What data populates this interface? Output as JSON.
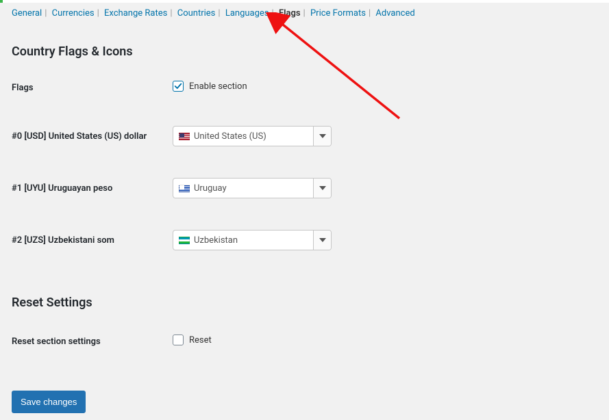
{
  "tabs": [
    {
      "label": "General",
      "active": false
    },
    {
      "label": "Currencies",
      "active": false
    },
    {
      "label": "Exchange Rates",
      "active": false
    },
    {
      "label": "Countries",
      "active": false
    },
    {
      "label": "Languages",
      "active": false
    },
    {
      "label": "Flags",
      "active": true
    },
    {
      "label": "Price Formats",
      "active": false
    },
    {
      "label": "Advanced",
      "active": false
    }
  ],
  "section": {
    "title": "Country Flags & Icons",
    "flags_label": "Flags",
    "enable_label": "Enable section",
    "enable_checked": true
  },
  "currency_rows": [
    {
      "label": "#0 [USD] United States (US) dollar",
      "selected": "United States (US)",
      "flag": "flag-us"
    },
    {
      "label": "#1 [UYU] Uruguayan peso",
      "selected": "Uruguay",
      "flag": "flag-uy"
    },
    {
      "label": "#2 [UZS] Uzbekistani som",
      "selected": "Uzbekistan",
      "flag": "flag-uz"
    }
  ],
  "reset": {
    "title": "Reset Settings",
    "label": "Reset section settings",
    "checkbox_label": "Reset",
    "checked": false
  },
  "buttons": {
    "save": "Save changes"
  }
}
